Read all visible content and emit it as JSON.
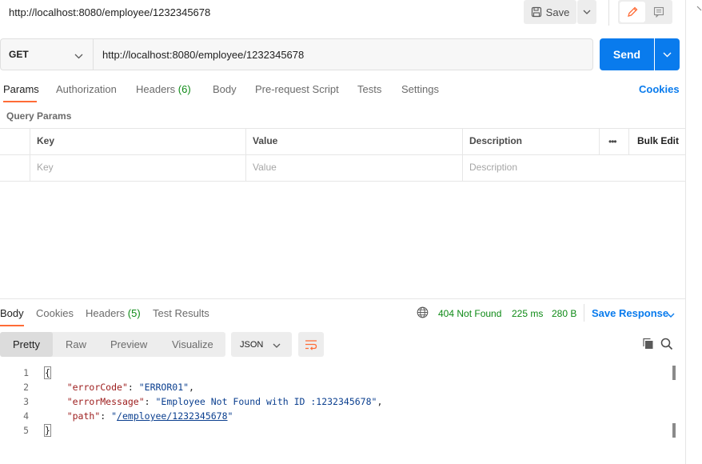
{
  "request": {
    "title": "http://localhost:8080/employee/1232345678",
    "method": "GET",
    "url": "http://localhost:8080/employee/1232345678",
    "save_label": "Save",
    "send_label": "Send"
  },
  "request_tabs": {
    "params": "Params",
    "authorization": "Authorization",
    "headers": "Headers",
    "headers_count": "(6)",
    "body": "Body",
    "prerequest": "Pre-request Script",
    "tests": "Tests",
    "settings": "Settings",
    "cookies": "Cookies"
  },
  "query_params": {
    "label": "Query Params",
    "columns": [
      "Key",
      "Value",
      "Description"
    ],
    "placeholders": [
      "Key",
      "Value",
      "Description"
    ],
    "more": "•••",
    "bulk_edit": "Bulk Edit"
  },
  "response_tabs": {
    "body": "Body",
    "cookies": "Cookies",
    "headers": "Headers",
    "headers_count": "(5)",
    "test_results": "Test Results"
  },
  "response_status": {
    "status": "404 Not Found",
    "time": "225 ms",
    "size": "280 B",
    "save_response": "Save Response"
  },
  "view": {
    "options": [
      "Pretty",
      "Raw",
      "Preview",
      "Visualize"
    ],
    "selected": "Pretty",
    "format": "JSON"
  },
  "response_body": {
    "line_numbers": [
      "1",
      "2",
      "3",
      "4",
      "5"
    ],
    "open_brace": "{",
    "close_brace": "}",
    "fields": [
      {
        "key": "\"errorCode\"",
        "value": "\"ERROR01\"",
        "trail": ","
      },
      {
        "key": "\"errorMessage\"",
        "value": "\"Employee Not Found with ID :1232345678\"",
        "trail": ","
      },
      {
        "key": "\"path\"",
        "value_prefix": "\"",
        "link": "/employee/1232345678",
        "value_suffix": "\"",
        "trail": ""
      }
    ]
  },
  "colors": {
    "accent": "#ff6c37",
    "primary": "#097bed",
    "status_ok_text": "#0e8a16",
    "json_key": "#9c1b1b",
    "json_string": "#0b3f8f"
  }
}
